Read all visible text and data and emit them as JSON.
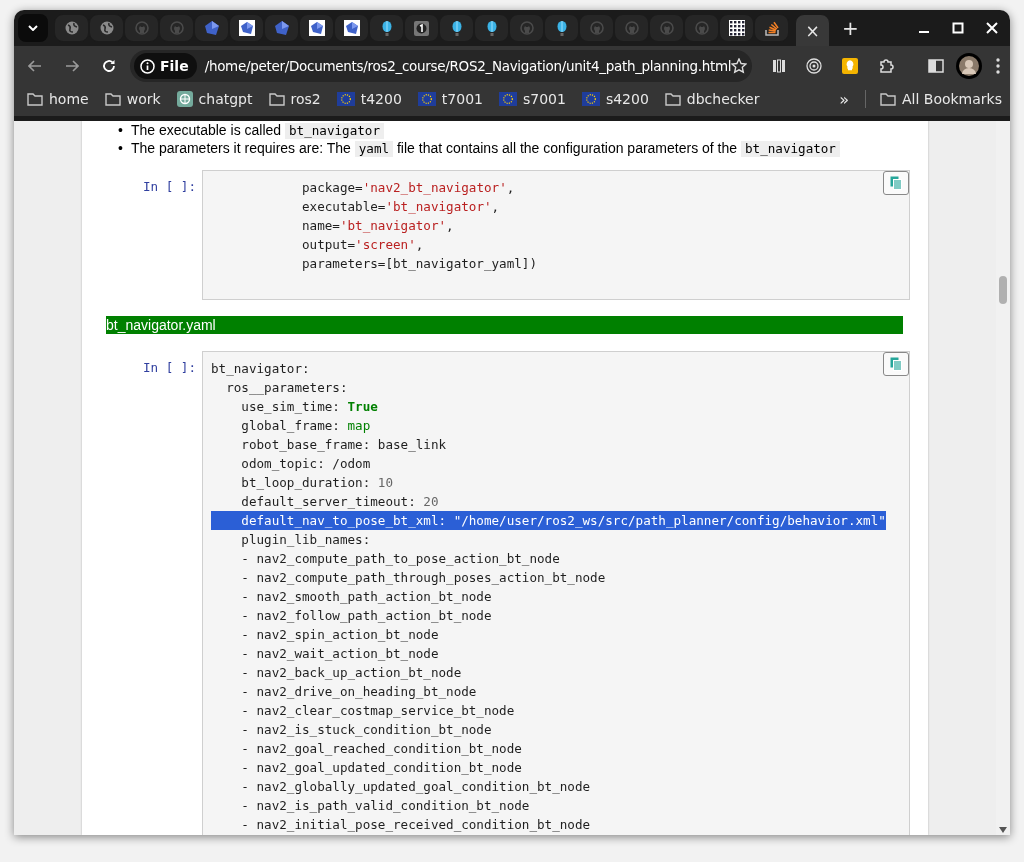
{
  "tabs": [
    {
      "kind": "globe",
      "selected": false
    },
    {
      "kind": "globe",
      "selected": false
    },
    {
      "kind": "cat",
      "selected": false
    },
    {
      "kind": "cat",
      "selected": false
    },
    {
      "kind": "cube",
      "selected": false
    },
    {
      "kind": "cube-tile",
      "selected": false
    },
    {
      "kind": "cube",
      "selected": false
    },
    {
      "kind": "cube-tile",
      "selected": false
    },
    {
      "kind": "cube-tile",
      "selected": false
    },
    {
      "kind": "balloon",
      "selected": false
    },
    {
      "kind": "badge",
      "selected": false
    },
    {
      "kind": "balloon",
      "selected": false
    },
    {
      "kind": "balloon",
      "selected": false
    },
    {
      "kind": "cat",
      "selected": false
    },
    {
      "kind": "balloon",
      "selected": false
    },
    {
      "kind": "cat",
      "selected": false
    },
    {
      "kind": "cat",
      "selected": false
    },
    {
      "kind": "cat",
      "selected": false
    },
    {
      "kind": "cat",
      "selected": false
    },
    {
      "kind": "grid",
      "selected": false
    },
    {
      "kind": "stack",
      "selected": false
    },
    {
      "kind": "blank",
      "selected": true,
      "close": "×"
    }
  ],
  "new_tab": "+",
  "address_bar": {
    "scheme_chip": "File",
    "url": "/home/peter/Documents/ros2_course/ROS2_Navigation/unit4_path_planning.html"
  },
  "bookmarks": [
    {
      "kind": "folder",
      "label": "home"
    },
    {
      "kind": "folder",
      "label": "work"
    },
    {
      "kind": "knot",
      "label": "chatgpt"
    },
    {
      "kind": "folder",
      "label": "ros2"
    },
    {
      "kind": "stars",
      "label": "t4200"
    },
    {
      "kind": "stars",
      "label": "t7001"
    },
    {
      "kind": "stars",
      "label": "s7001"
    },
    {
      "kind": "stars",
      "label": "s4200"
    },
    {
      "kind": "folder",
      "label": "dbchecker"
    }
  ],
  "bookmarks_overflow": "»",
  "all_bookmarks": "All Bookmarks",
  "bullets": [
    {
      "marker": "•",
      "segments": [
        {
          "text": "The executable is called ",
          "kind": "text"
        },
        {
          "text": "bt_navigator",
          "kind": "code"
        }
      ]
    },
    {
      "marker": "•",
      "segments": [
        {
          "text": "The parameters it requires are: The ",
          "kind": "text"
        },
        {
          "text": "yaml",
          "kind": "code"
        },
        {
          "text": " file that contains all the configuration parameters of the ",
          "kind": "text"
        },
        {
          "text": "bt_navigator",
          "kind": "code"
        }
      ]
    }
  ],
  "cells": [
    {
      "kind": "code",
      "prompt": "In [ ]:",
      "lines": [
        {
          "selected": false,
          "segments": [
            {
              "text": "            package=",
              "kind": "plain"
            },
            {
              "text": "'nav2_bt_navigator'",
              "kind": "string"
            },
            {
              "text": ",",
              "kind": "plain"
            }
          ]
        },
        {
          "selected": false,
          "segments": [
            {
              "text": "            executable=",
              "kind": "plain"
            },
            {
              "text": "'bt_navigator'",
              "kind": "string"
            },
            {
              "text": ",",
              "kind": "plain"
            }
          ]
        },
        {
          "selected": false,
          "segments": [
            {
              "text": "            name=",
              "kind": "plain"
            },
            {
              "text": "'bt_navigator'",
              "kind": "string"
            },
            {
              "text": ",",
              "kind": "plain"
            }
          ]
        },
        {
          "selected": false,
          "segments": [
            {
              "text": "            output=",
              "kind": "plain"
            },
            {
              "text": "'screen'",
              "kind": "string"
            },
            {
              "text": ",",
              "kind": "plain"
            }
          ]
        },
        {
          "selected": false,
          "segments": [
            {
              "text": "            parameters=[bt_navigator_yaml])",
              "kind": "plain"
            }
          ]
        }
      ]
    },
    {
      "kind": "banner",
      "text": "bt_navigator.yaml"
    },
    {
      "kind": "code",
      "prompt": "In [ ]:",
      "lines": [
        {
          "selected": false,
          "segments": [
            {
              "text": "bt_navigator:",
              "kind": "plain"
            }
          ]
        },
        {
          "selected": false,
          "segments": [
            {
              "text": "  ros__parameters:",
              "kind": "plain"
            }
          ]
        },
        {
          "selected": false,
          "segments": [
            {
              "text": "    use_sim_time: ",
              "kind": "plain"
            },
            {
              "text": "True",
              "kind": "keyword"
            }
          ]
        },
        {
          "selected": false,
          "segments": [
            {
              "text": "    global_frame: ",
              "kind": "plain"
            },
            {
              "text": "map",
              "kind": "builtin"
            }
          ]
        },
        {
          "selected": false,
          "segments": [
            {
              "text": "    robot_base_frame: base_link",
              "kind": "plain"
            }
          ]
        },
        {
          "selected": false,
          "segments": [
            {
              "text": "    odom_topic: /odom",
              "kind": "plain"
            }
          ]
        },
        {
          "selected": false,
          "segments": [
            {
              "text": "    bt_loop_duration: ",
              "kind": "plain"
            },
            {
              "text": "10",
              "kind": "number"
            }
          ]
        },
        {
          "selected": false,
          "segments": [
            {
              "text": "    default_server_timeout: ",
              "kind": "plain"
            },
            {
              "text": "20",
              "kind": "number"
            }
          ]
        },
        {
          "selected": true,
          "segments": [
            {
              "text": "    default_nav_to_pose_bt_xml: \"/home/user/ros2_ws/src/path_planner/config/behavior.xml\"",
              "kind": "plain"
            }
          ]
        },
        {
          "selected": false,
          "segments": [
            {
              "text": "    plugin_lib_names:",
              "kind": "plain"
            }
          ]
        },
        {
          "selected": false,
          "segments": [
            {
              "text": "    - nav2_compute_path_to_pose_action_bt_node",
              "kind": "plain"
            }
          ]
        },
        {
          "selected": false,
          "segments": [
            {
              "text": "    - nav2_compute_path_through_poses_action_bt_node",
              "kind": "plain"
            }
          ]
        },
        {
          "selected": false,
          "segments": [
            {
              "text": "    - nav2_smooth_path_action_bt_node",
              "kind": "plain"
            }
          ]
        },
        {
          "selected": false,
          "segments": [
            {
              "text": "    - nav2_follow_path_action_bt_node",
              "kind": "plain"
            }
          ]
        },
        {
          "selected": false,
          "segments": [
            {
              "text": "    - nav2_spin_action_bt_node",
              "kind": "plain"
            }
          ]
        },
        {
          "selected": false,
          "segments": [
            {
              "text": "    - nav2_wait_action_bt_node",
              "kind": "plain"
            }
          ]
        },
        {
          "selected": false,
          "segments": [
            {
              "text": "    - nav2_back_up_action_bt_node",
              "kind": "plain"
            }
          ]
        },
        {
          "selected": false,
          "segments": [
            {
              "text": "    - nav2_drive_on_heading_bt_node",
              "kind": "plain"
            }
          ]
        },
        {
          "selected": false,
          "segments": [
            {
              "text": "    - nav2_clear_costmap_service_bt_node",
              "kind": "plain"
            }
          ]
        },
        {
          "selected": false,
          "segments": [
            {
              "text": "    - nav2_is_stuck_condition_bt_node",
              "kind": "plain"
            }
          ]
        },
        {
          "selected": false,
          "segments": [
            {
              "text": "    - nav2_goal_reached_condition_bt_node",
              "kind": "plain"
            }
          ]
        },
        {
          "selected": false,
          "segments": [
            {
              "text": "    - nav2_goal_updated_condition_bt_node",
              "kind": "plain"
            }
          ]
        },
        {
          "selected": false,
          "segments": [
            {
              "text": "    - nav2_globally_updated_goal_condition_bt_node",
              "kind": "plain"
            }
          ]
        },
        {
          "selected": false,
          "segments": [
            {
              "text": "    - nav2_is_path_valid_condition_bt_node",
              "kind": "plain"
            }
          ]
        },
        {
          "selected": false,
          "segments": [
            {
              "text": "    - nav2_initial_pose_received_condition_bt_node",
              "kind": "plain"
            }
          ]
        }
      ]
    }
  ]
}
